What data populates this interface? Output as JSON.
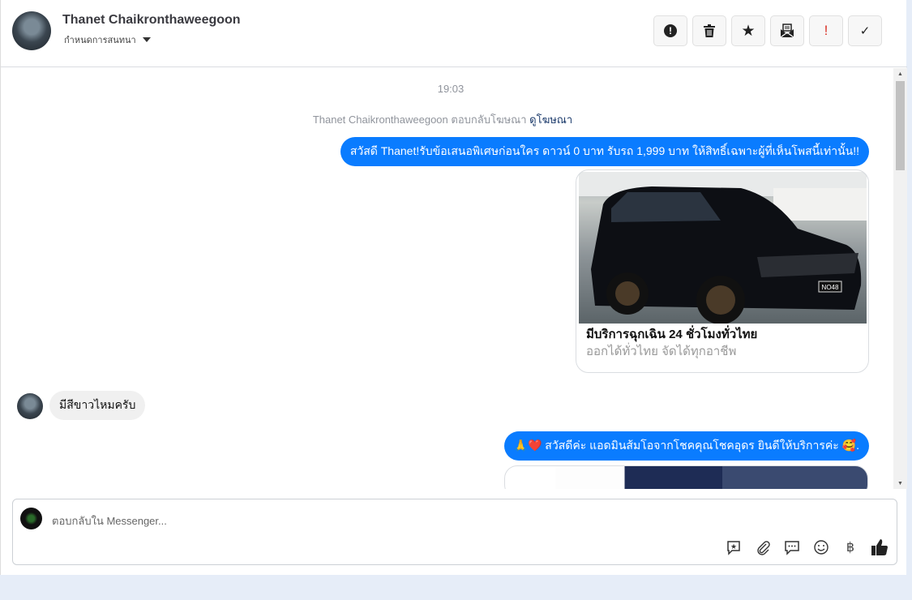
{
  "header": {
    "name": "Thanet Chaikronthaweegoon",
    "subtitle": "กำหนดการสนทนา",
    "actions": [
      {
        "icon": "alert-circle-icon",
        "glyph": "!"
      },
      {
        "icon": "trash-icon",
        "glyph": "🗑"
      },
      {
        "icon": "star-icon",
        "glyph": "★"
      },
      {
        "icon": "envelope-open-icon",
        "glyph": "✉"
      },
      {
        "icon": "exclamation-icon",
        "glyph": "!"
      },
      {
        "icon": "check-icon",
        "glyph": "✓"
      }
    ]
  },
  "thread": {
    "time": "19:03",
    "notice": "Thanet Chaikronthaweegoon ตอบกลับโฆษณา",
    "notice_link": "ดูโฆษณา",
    "msg1": "สวัสดี Thanet!รับข้อเสนอพิเศษก่อนใคร ดาวน์ 0 บาท รับรถ 1,999 บาท ให้สิทธิ์เฉพาะผู้ที่เห็นโพสนี้เท่านั้น!!",
    "card_title": "มีบริการฉุกเฉิน 24 ชั่วโมงทั่วไทย",
    "card_desc": "ออกได้ทั่วไทย จัดได้ทุกอาชีพ",
    "plate": "NO48",
    "msg2": "มีสีขาวไหมครับ",
    "msg3": "🙏❤️ สวัสดีค่ะ แอดมินส้มโอจากโชคคุณโชคอุดร ยินดีให้บริการค่ะ 🥰."
  },
  "composer": {
    "placeholder": "ตอบกลับใน Messenger...",
    "baht": "฿"
  }
}
